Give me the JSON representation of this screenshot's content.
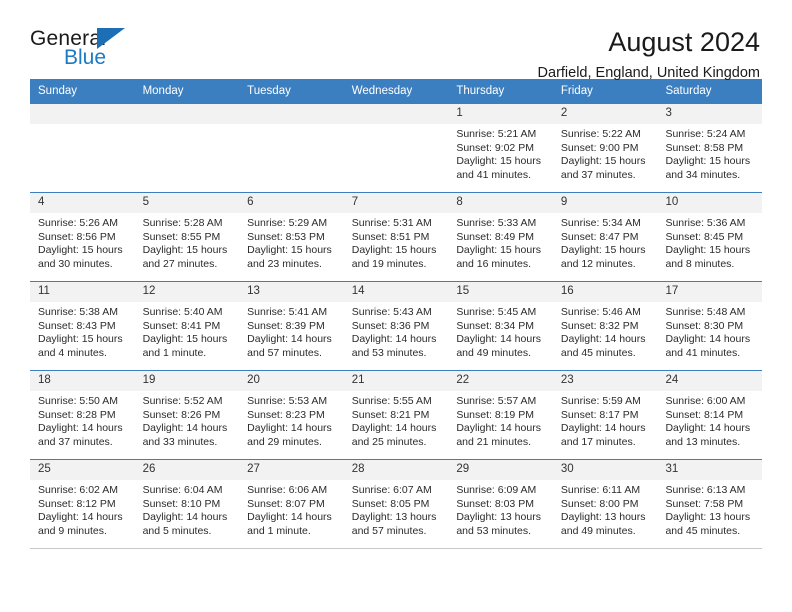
{
  "brand": {
    "name_line1": "General",
    "name_line2": "Blue",
    "accent_color": "#1c7bc4"
  },
  "header": {
    "title": "August 2024",
    "subtitle": "Darfield, England, United Kingdom"
  },
  "calendar": {
    "header_color": "#3c7fc1",
    "weekdays": [
      "Sunday",
      "Monday",
      "Tuesday",
      "Wednesday",
      "Thursday",
      "Friday",
      "Saturday"
    ],
    "weeks": [
      [
        {
          "day": "",
          "empty": true
        },
        {
          "day": "",
          "empty": true
        },
        {
          "day": "",
          "empty": true
        },
        {
          "day": "",
          "empty": true
        },
        {
          "day": "1",
          "sunrise": "Sunrise: 5:21 AM",
          "sunset": "Sunset: 9:02 PM",
          "daylight_line1": "Daylight: 15 hours",
          "daylight_line2": "and 41 minutes."
        },
        {
          "day": "2",
          "sunrise": "Sunrise: 5:22 AM",
          "sunset": "Sunset: 9:00 PM",
          "daylight_line1": "Daylight: 15 hours",
          "daylight_line2": "and 37 minutes."
        },
        {
          "day": "3",
          "sunrise": "Sunrise: 5:24 AM",
          "sunset": "Sunset: 8:58 PM",
          "daylight_line1": "Daylight: 15 hours",
          "daylight_line2": "and 34 minutes."
        }
      ],
      [
        {
          "day": "4",
          "sunrise": "Sunrise: 5:26 AM",
          "sunset": "Sunset: 8:56 PM",
          "daylight_line1": "Daylight: 15 hours",
          "daylight_line2": "and 30 minutes."
        },
        {
          "day": "5",
          "sunrise": "Sunrise: 5:28 AM",
          "sunset": "Sunset: 8:55 PM",
          "daylight_line1": "Daylight: 15 hours",
          "daylight_line2": "and 27 minutes."
        },
        {
          "day": "6",
          "sunrise": "Sunrise: 5:29 AM",
          "sunset": "Sunset: 8:53 PM",
          "daylight_line1": "Daylight: 15 hours",
          "daylight_line2": "and 23 minutes."
        },
        {
          "day": "7",
          "sunrise": "Sunrise: 5:31 AM",
          "sunset": "Sunset: 8:51 PM",
          "daylight_line1": "Daylight: 15 hours",
          "daylight_line2": "and 19 minutes."
        },
        {
          "day": "8",
          "sunrise": "Sunrise: 5:33 AM",
          "sunset": "Sunset: 8:49 PM",
          "daylight_line1": "Daylight: 15 hours",
          "daylight_line2": "and 16 minutes."
        },
        {
          "day": "9",
          "sunrise": "Sunrise: 5:34 AM",
          "sunset": "Sunset: 8:47 PM",
          "daylight_line1": "Daylight: 15 hours",
          "daylight_line2": "and 12 minutes."
        },
        {
          "day": "10",
          "sunrise": "Sunrise: 5:36 AM",
          "sunset": "Sunset: 8:45 PM",
          "daylight_line1": "Daylight: 15 hours",
          "daylight_line2": "and 8 minutes."
        }
      ],
      [
        {
          "day": "11",
          "sunrise": "Sunrise: 5:38 AM",
          "sunset": "Sunset: 8:43 PM",
          "daylight_line1": "Daylight: 15 hours",
          "daylight_line2": "and 4 minutes."
        },
        {
          "day": "12",
          "sunrise": "Sunrise: 5:40 AM",
          "sunset": "Sunset: 8:41 PM",
          "daylight_line1": "Daylight: 15 hours",
          "daylight_line2": "and 1 minute."
        },
        {
          "day": "13",
          "sunrise": "Sunrise: 5:41 AM",
          "sunset": "Sunset: 8:39 PM",
          "daylight_line1": "Daylight: 14 hours",
          "daylight_line2": "and 57 minutes."
        },
        {
          "day": "14",
          "sunrise": "Sunrise: 5:43 AM",
          "sunset": "Sunset: 8:36 PM",
          "daylight_line1": "Daylight: 14 hours",
          "daylight_line2": "and 53 minutes."
        },
        {
          "day": "15",
          "sunrise": "Sunrise: 5:45 AM",
          "sunset": "Sunset: 8:34 PM",
          "daylight_line1": "Daylight: 14 hours",
          "daylight_line2": "and 49 minutes."
        },
        {
          "day": "16",
          "sunrise": "Sunrise: 5:46 AM",
          "sunset": "Sunset: 8:32 PM",
          "daylight_line1": "Daylight: 14 hours",
          "daylight_line2": "and 45 minutes."
        },
        {
          "day": "17",
          "sunrise": "Sunrise: 5:48 AM",
          "sunset": "Sunset: 8:30 PM",
          "daylight_line1": "Daylight: 14 hours",
          "daylight_line2": "and 41 minutes."
        }
      ],
      [
        {
          "day": "18",
          "sunrise": "Sunrise: 5:50 AM",
          "sunset": "Sunset: 8:28 PM",
          "daylight_line1": "Daylight: 14 hours",
          "daylight_line2": "and 37 minutes."
        },
        {
          "day": "19",
          "sunrise": "Sunrise: 5:52 AM",
          "sunset": "Sunset: 8:26 PM",
          "daylight_line1": "Daylight: 14 hours",
          "daylight_line2": "and 33 minutes."
        },
        {
          "day": "20",
          "sunrise": "Sunrise: 5:53 AM",
          "sunset": "Sunset: 8:23 PM",
          "daylight_line1": "Daylight: 14 hours",
          "daylight_line2": "and 29 minutes."
        },
        {
          "day": "21",
          "sunrise": "Sunrise: 5:55 AM",
          "sunset": "Sunset: 8:21 PM",
          "daylight_line1": "Daylight: 14 hours",
          "daylight_line2": "and 25 minutes."
        },
        {
          "day": "22",
          "sunrise": "Sunrise: 5:57 AM",
          "sunset": "Sunset: 8:19 PM",
          "daylight_line1": "Daylight: 14 hours",
          "daylight_line2": "and 21 minutes."
        },
        {
          "day": "23",
          "sunrise": "Sunrise: 5:59 AM",
          "sunset": "Sunset: 8:17 PM",
          "daylight_line1": "Daylight: 14 hours",
          "daylight_line2": "and 17 minutes."
        },
        {
          "day": "24",
          "sunrise": "Sunrise: 6:00 AM",
          "sunset": "Sunset: 8:14 PM",
          "daylight_line1": "Daylight: 14 hours",
          "daylight_line2": "and 13 minutes."
        }
      ],
      [
        {
          "day": "25",
          "sunrise": "Sunrise: 6:02 AM",
          "sunset": "Sunset: 8:12 PM",
          "daylight_line1": "Daylight: 14 hours",
          "daylight_line2": "and 9 minutes."
        },
        {
          "day": "26",
          "sunrise": "Sunrise: 6:04 AM",
          "sunset": "Sunset: 8:10 PM",
          "daylight_line1": "Daylight: 14 hours",
          "daylight_line2": "and 5 minutes."
        },
        {
          "day": "27",
          "sunrise": "Sunrise: 6:06 AM",
          "sunset": "Sunset: 8:07 PM",
          "daylight_line1": "Daylight: 14 hours",
          "daylight_line2": "and 1 minute."
        },
        {
          "day": "28",
          "sunrise": "Sunrise: 6:07 AM",
          "sunset": "Sunset: 8:05 PM",
          "daylight_line1": "Daylight: 13 hours",
          "daylight_line2": "and 57 minutes."
        },
        {
          "day": "29",
          "sunrise": "Sunrise: 6:09 AM",
          "sunset": "Sunset: 8:03 PM",
          "daylight_line1": "Daylight: 13 hours",
          "daylight_line2": "and 53 minutes."
        },
        {
          "day": "30",
          "sunrise": "Sunrise: 6:11 AM",
          "sunset": "Sunset: 8:00 PM",
          "daylight_line1": "Daylight: 13 hours",
          "daylight_line2": "and 49 minutes."
        },
        {
          "day": "31",
          "sunrise": "Sunrise: 6:13 AM",
          "sunset": "Sunset: 7:58 PM",
          "daylight_line1": "Daylight: 13 hours",
          "daylight_line2": "and 45 minutes."
        }
      ]
    ]
  }
}
